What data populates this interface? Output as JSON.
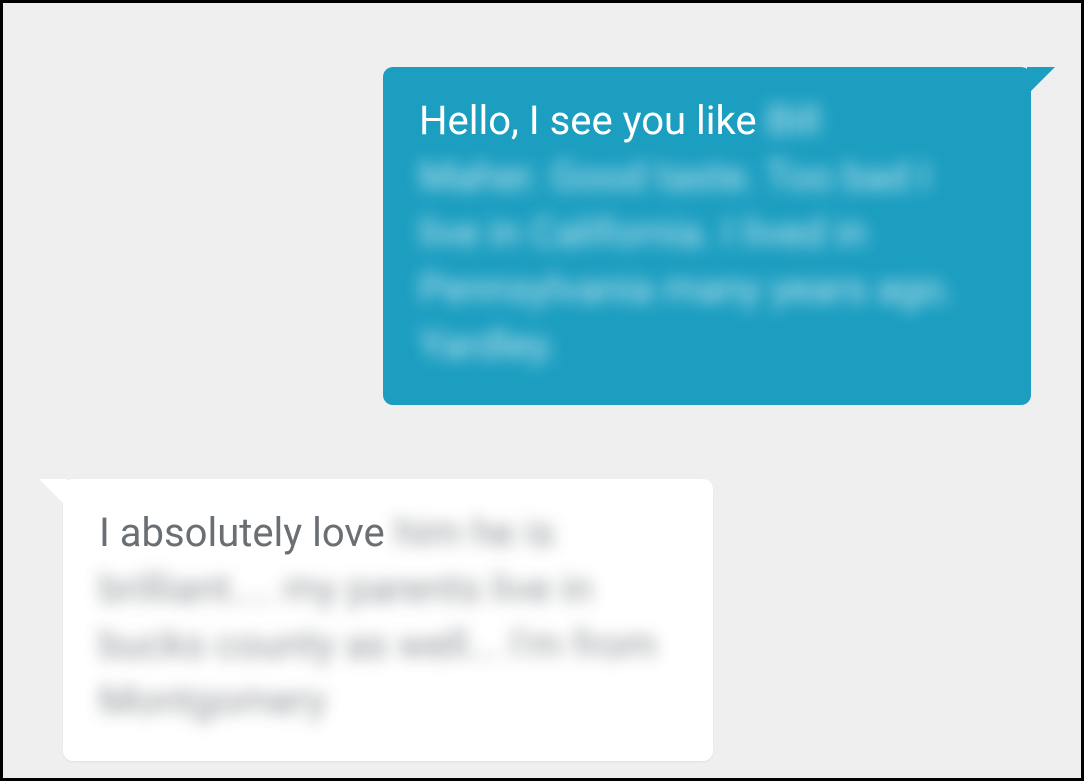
{
  "colors": {
    "sent_bubble_bg": "#1c9ec1",
    "sent_text": "#ffffff",
    "recv_bubble_bg": "#ffffff",
    "recv_text": "#6a6f74",
    "page_bg": "#efefef"
  },
  "messages": {
    "sent": {
      "visible_prefix": "Hello, I see you like ",
      "blurred_tail_line1": "Bill",
      "blurred_rest": "Maher. Good taste. Too bad I live in California. I lived in Pennsylvania many years ago. Yardley."
    },
    "received": {
      "visible_prefix": "I absolutely love ",
      "blurred_tail_line1": "him he is",
      "blurred_rest": "brilliant.... my parents live in bucks county as well... I'm from Montgomery"
    }
  }
}
